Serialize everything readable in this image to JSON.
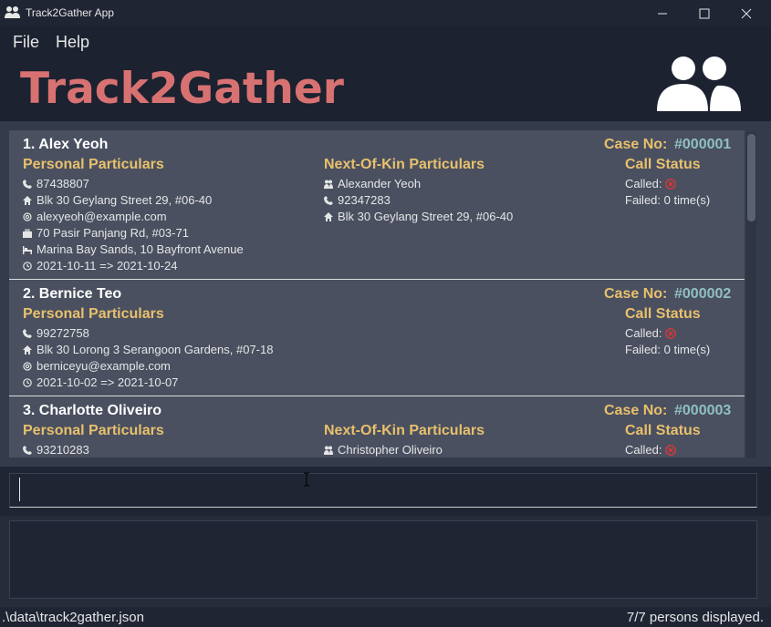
{
  "window": {
    "title": "Track2Gather App",
    "icons": {
      "app": "people-icon",
      "minimize": "minimize-icon",
      "maximize": "maximize-icon",
      "close": "close-icon"
    }
  },
  "menu": {
    "file": "File",
    "help": "Help"
  },
  "banner": {
    "title": "Track2Gather",
    "logo": "people-icon"
  },
  "colors": {
    "accent": "#d87272",
    "section": "#e8c06c",
    "case_no": "#8fc0c0",
    "call_failed": "#d63838"
  },
  "labels": {
    "case_no": "Case No:",
    "personal": "Personal Particulars",
    "nok": "Next-Of-Kin Particulars",
    "call_status": "Call Status",
    "called": "Called:",
    "failed_prefix": "Failed:"
  },
  "persons": [
    {
      "name": "1.  Alex Yeoh",
      "case_no": "#000001",
      "phone": "87438807",
      "home": "Blk 30 Geylang Street 29, #06-40",
      "email": "alexyeoh@example.com",
      "work": "70 Pasir Panjang Rd, #03-71",
      "quarantine": "Marina Bay Sands, 10 Bayfront Avenue",
      "period": "2021-10-11 => 2021-10-24",
      "nok_name": "Alexander Yeoh",
      "nok_phone": "92347283",
      "nok_address": "Blk 30 Geylang Street 29, #06-40",
      "called_icon": "x-circle-icon",
      "failed": "Failed: 0 time(s)"
    },
    {
      "name": "2.  Bernice Teo",
      "case_no": "#000002",
      "phone": "99272758",
      "home": "Blk 30 Lorong 3 Serangoon Gardens, #07-18",
      "email": "berniceyu@example.com",
      "period": "2021-10-02 => 2021-10-07",
      "called_icon": "x-circle-icon",
      "failed": "Failed: 0 time(s)"
    },
    {
      "name": "3.  Charlotte Oliveiro",
      "case_no": "#000003",
      "phone": "93210283",
      "nok_name": "Christopher Oliveiro",
      "called_icon": "x-circle-icon"
    }
  ],
  "command": {
    "value": ""
  },
  "status": {
    "path": ".\\data\\track2gather.json",
    "count": "7/7 persons displayed."
  }
}
